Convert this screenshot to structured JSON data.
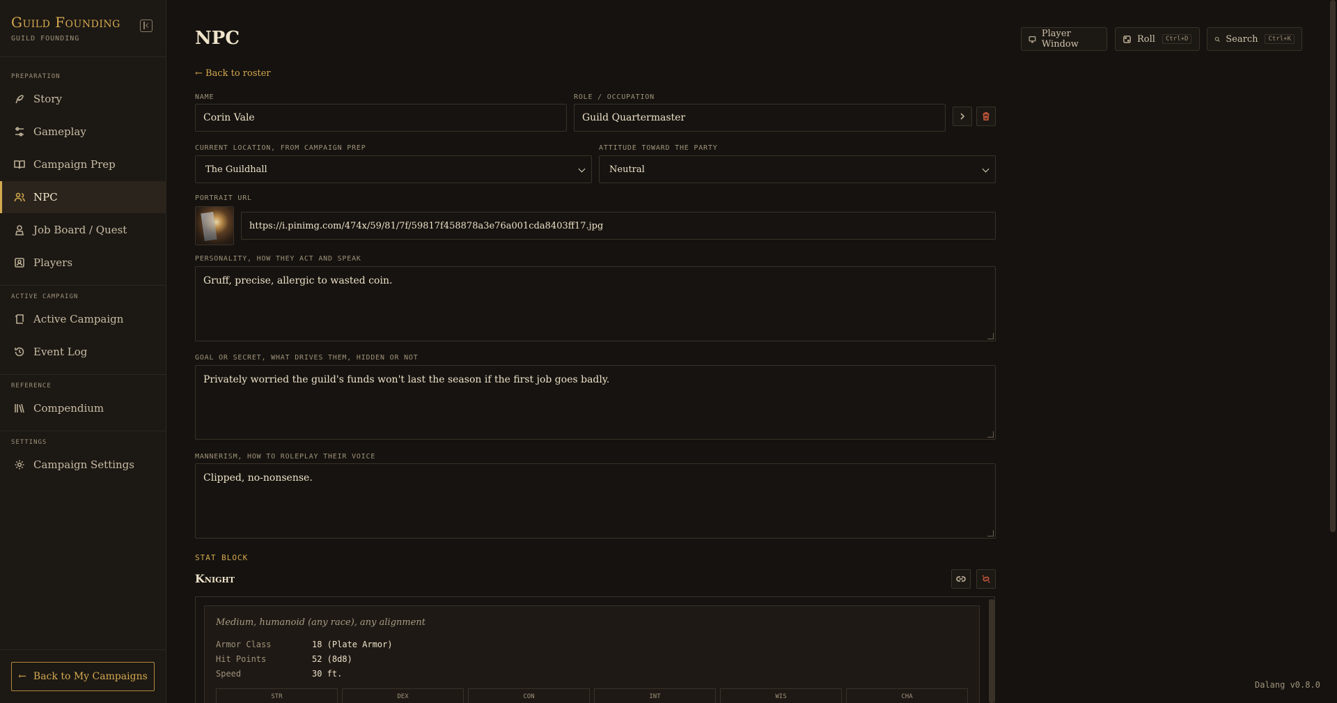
{
  "sidebar": {
    "title": "Guild Founding",
    "subtitle": "GUILD FOUNDING",
    "sections": {
      "preparation": "PREPARATION",
      "active": "ACTIVE CAMPAIGN",
      "reference": "REFERENCE",
      "settings": "SETTINGS"
    },
    "items": {
      "story": "Story",
      "gameplay": "Gameplay",
      "campaign_prep": "Campaign Prep",
      "npc": "NPC",
      "job_board": "Job Board / Quest",
      "players": "Players",
      "active_campaign": "Active Campaign",
      "event_log": "Event Log",
      "compendium": "Compendium",
      "campaign_settings": "Campaign Settings"
    },
    "active_item": "npc",
    "back_label": "Back to My Campaigns"
  },
  "header": {
    "title": "NPC",
    "player_window": "Player Window",
    "roll": "Roll",
    "roll_kbd": "Ctrl+D",
    "search": "Search",
    "search_kbd": "Ctrl+K"
  },
  "back_roster": "← Back to roster",
  "form": {
    "name_label": "NAME",
    "name_value": "Corin Vale",
    "role_label": "ROLE / OCCUPATION",
    "role_value": "Guild Quartermaster",
    "location_label": "CURRENT LOCATION, FROM CAMPAIGN PREP",
    "location_value": "The Guildhall",
    "attitude_label": "ATTITUDE TOWARD THE PARTY",
    "attitude_value": "Neutral",
    "portrait_label": "PORTRAIT URL",
    "portrait_value": "https://i.pinimg.com/474x/59/81/7f/59817f458878a3e76a001cda8403ff17.jpg",
    "personality_label": "PERSONALITY, HOW THEY ACT AND SPEAK",
    "personality_value": "Gruff, precise, allergic to wasted coin.",
    "goal_label": "GOAL OR SECRET, WHAT DRIVES THEM, HIDDEN OR NOT",
    "goal_value": "Privately worried the guild's funds won't last the season if the first job goes badly.",
    "mannerism_label": "MANNERISM, HOW TO ROLEPLAY THEIR VOICE",
    "mannerism_value": "Clipped, no-nonsense."
  },
  "stat_block": {
    "label": "STAT BLOCK",
    "name": "Knight",
    "type_line": "Medium, humanoid (any race), any alignment",
    "armor_class_label": "Armor Class",
    "armor_class": "18 (Plate Armor)",
    "hit_points_label": "Hit Points",
    "hit_points": "52 (8d8)",
    "speed_label": "Speed",
    "speed": "30 ft.",
    "abilities": [
      "STR",
      "DEX",
      "CON",
      "INT",
      "WIS",
      "CHA"
    ]
  },
  "version": "Dalang v0.8.0",
  "colors": {
    "accent": "#d4a94f",
    "background": "#15120f",
    "danger": "#c0553a"
  }
}
